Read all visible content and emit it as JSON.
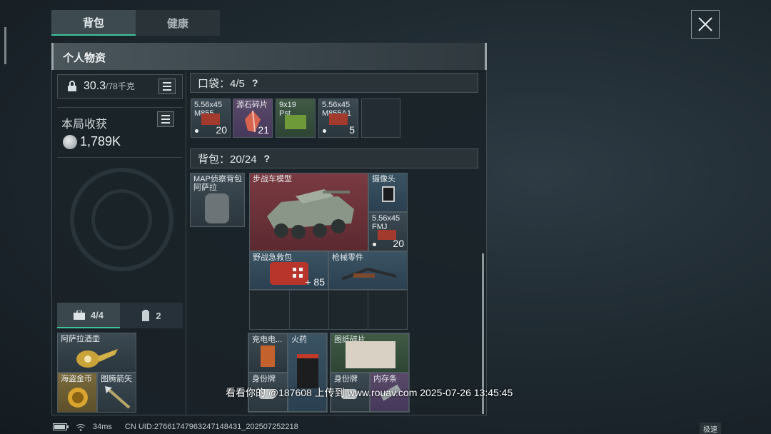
{
  "tabs": [
    {
      "label": "背包",
      "active": true
    },
    {
      "label": "健康",
      "active": false
    }
  ],
  "panel": {
    "title": "个人物资"
  },
  "weight": {
    "current": "30.3",
    "max": "/78千克"
  },
  "loot": {
    "label": "本局收获",
    "value": "1,789K"
  },
  "subtabs": [
    {
      "icon": "toolbox-icon",
      "label": "4/4"
    },
    {
      "icon": "canister-icon",
      "label": "2"
    }
  ],
  "pocket": {
    "label": "口袋：4/5",
    "help": "?"
  },
  "backpack": {
    "label": "背包：20/24",
    "help": "?"
  },
  "pocket_items": [
    {
      "name": "5.56x45\nM855",
      "count": "20",
      "color": "grey",
      "dot": true
    },
    {
      "name": "源石碎片",
      "count": "21",
      "color": "purple",
      "dot": false
    },
    {
      "name": "9x19\nPst",
      "count": "",
      "color": "green",
      "dot": false
    },
    {
      "name": "5.56x45\nM855A1",
      "count": "5",
      "color": "grey",
      "dot": true
    }
  ],
  "secure_items": [
    {
      "name": "阿萨拉酒壶"
    },
    {
      "name": "海盗金币"
    },
    {
      "name": "图腾箭矢"
    }
  ],
  "backpack_items": [
    {
      "name": "MAP侦察背包\n阿萨拉"
    },
    {
      "name": "步战车模型"
    },
    {
      "name": "摄像头"
    },
    {
      "name": "5.56x45\nFMJ",
      "count": "20"
    },
    {
      "name": "野战急救包",
      "count": "+ 85"
    },
    {
      "name": "枪械零件"
    }
  ],
  "container_items": [
    {
      "name": "充电电..."
    },
    {
      "name": "火药"
    },
    {
      "name": "图纸碎片"
    },
    {
      "name": "身份牌"
    },
    {
      "name": "身份牌"
    },
    {
      "name": "内存条"
    }
  ],
  "status": {
    "ping": "34ms",
    "uid": "CN UID:27661747963247148431_202507252218",
    "speed": "极速"
  },
  "watermark": "看看你的 @187608 上传到 www.rouav.com 2025-07-26 13:45:45",
  "colors": {
    "accent": "#3fc59a",
    "rare_red": "#7a3a41",
    "epic_purple": "#5b4a6a"
  }
}
